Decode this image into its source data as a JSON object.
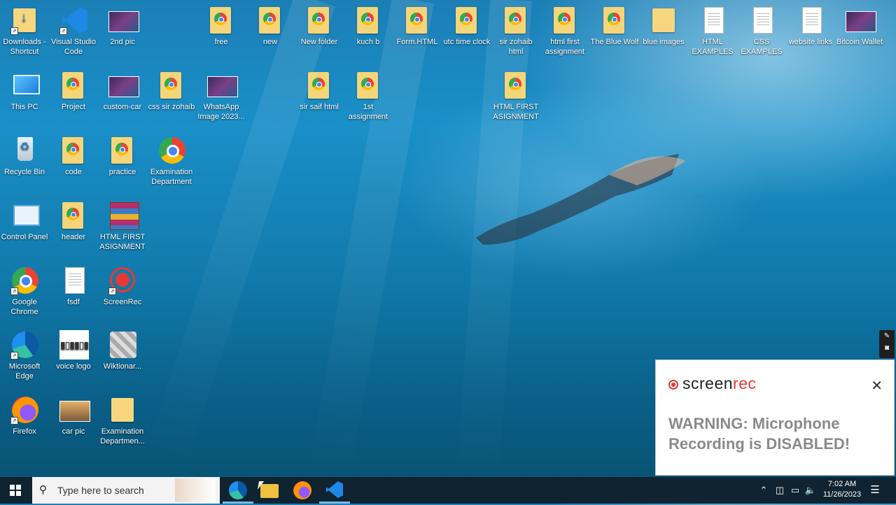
{
  "desktop": {
    "icons": [
      {
        "label": "Downloads - Shortcut",
        "kind": "folder-download-icon",
        "shortcut": true
      },
      {
        "label": "This PC",
        "kind": "this-pc-icon",
        "shortcut": false
      },
      {
        "label": "Recycle Bin",
        "kind": "recycle-bin-icon",
        "shortcut": false
      },
      {
        "label": "Control Panel",
        "kind": "control-panel-icon",
        "shortcut": false
      },
      {
        "label": "Google Chrome",
        "kind": "chrome-icon",
        "shortcut": true
      },
      {
        "label": "Microsoft Edge",
        "kind": "edge-icon",
        "shortcut": true
      },
      {
        "label": "Firefox",
        "kind": "firefox-icon",
        "shortcut": true
      },
      {
        "label": "Visual Studio Code",
        "kind": "vscode-icon",
        "shortcut": true
      },
      {
        "label": "Project",
        "kind": "folder-doc-icon",
        "shortcut": false
      },
      {
        "label": "code",
        "kind": "folder-doc-icon",
        "shortcut": false
      },
      {
        "label": "header",
        "kind": "folder-doc-icon",
        "shortcut": false
      },
      {
        "label": "fsdf",
        "kind": "text-file-icon",
        "shortcut": false
      },
      {
        "label": "voice logo",
        "kind": "voice-logo-image-icon",
        "shortcut": false
      },
      {
        "label": "car pic",
        "kind": "car-image-icon",
        "shortcut": false
      },
      {
        "label": "2nd pic",
        "kind": "image-icon",
        "shortcut": false
      },
      {
        "label": "custom-car",
        "kind": "image-icon",
        "shortcut": false
      },
      {
        "label": "practice",
        "kind": "folder-doc-icon",
        "shortcut": false
      },
      {
        "label": "HTML FIRST ASIGNMENT",
        "kind": "winrar-icon",
        "shortcut": false
      },
      {
        "label": "ScreenRec",
        "kind": "screenrec-icon",
        "shortcut": true
      },
      {
        "label": "Wiktionar...",
        "kind": "wiktionary-icon",
        "shortcut": false
      },
      {
        "label": "Examination Departmen...",
        "kind": "folder-icon",
        "shortcut": false
      },
      {
        "label": "css sir zohaib",
        "kind": "folder-doc-icon",
        "shortcut": false
      },
      {
        "label": "Examination Department",
        "kind": "chrome-icon",
        "shortcut": false
      },
      {
        "label": "free",
        "kind": "folder-doc-icon",
        "shortcut": false
      },
      {
        "label": "WhatsApp Image 2023...",
        "kind": "image-icon",
        "shortcut": false
      },
      {
        "label": "new",
        "kind": "folder-doc-icon",
        "shortcut": false
      },
      {
        "label": "New folder",
        "kind": "folder-doc-icon",
        "shortcut": false
      },
      {
        "label": "sir saif html",
        "kind": "folder-doc-icon",
        "shortcut": false
      },
      {
        "label": "kuch b",
        "kind": "folder-doc-icon",
        "shortcut": false
      },
      {
        "label": "1st assignment",
        "kind": "folder-doc-icon",
        "shortcut": false
      },
      {
        "label": "Form.HTML",
        "kind": "folder-doc-icon",
        "shortcut": false
      },
      {
        "label": "utc time clock",
        "kind": "folder-doc-icon",
        "shortcut": false
      },
      {
        "label": "sir zohaib html",
        "kind": "folder-doc-icon",
        "shortcut": false
      },
      {
        "label": "HTML FIRST ASIGNMENT",
        "kind": "folder-doc-icon",
        "shortcut": false
      },
      {
        "label": "html first assignment",
        "kind": "folder-doc-icon",
        "shortcut": false
      },
      {
        "label": "The Blue Wolf",
        "kind": "folder-doc-icon",
        "shortcut": false
      },
      {
        "label": "blue images",
        "kind": "folder-icon",
        "shortcut": false
      },
      {
        "label": "HTML EXAMPLES",
        "kind": "text-file-icon",
        "shortcut": false
      },
      {
        "label": "CSS EXAMPLES",
        "kind": "text-file-icon",
        "shortcut": false
      },
      {
        "label": "website links",
        "kind": "text-file-icon",
        "shortcut": false
      },
      {
        "label": "Bitcoin Wallet",
        "kind": "image-icon",
        "shortcut": false
      }
    ]
  },
  "taskbar": {
    "search_placeholder": "Type here to search",
    "apps": [
      "edge-icon",
      "file-explorer-icon",
      "firefox-icon",
      "vscode-icon"
    ],
    "clock_time": "7:02 AM",
    "clock_date": "11/26/2023"
  },
  "popup": {
    "brand_screen": "screen",
    "brand_rec": "rec",
    "message": "WARNING: Microphone Recording is DISABLED!",
    "close_glyph": "✕"
  }
}
